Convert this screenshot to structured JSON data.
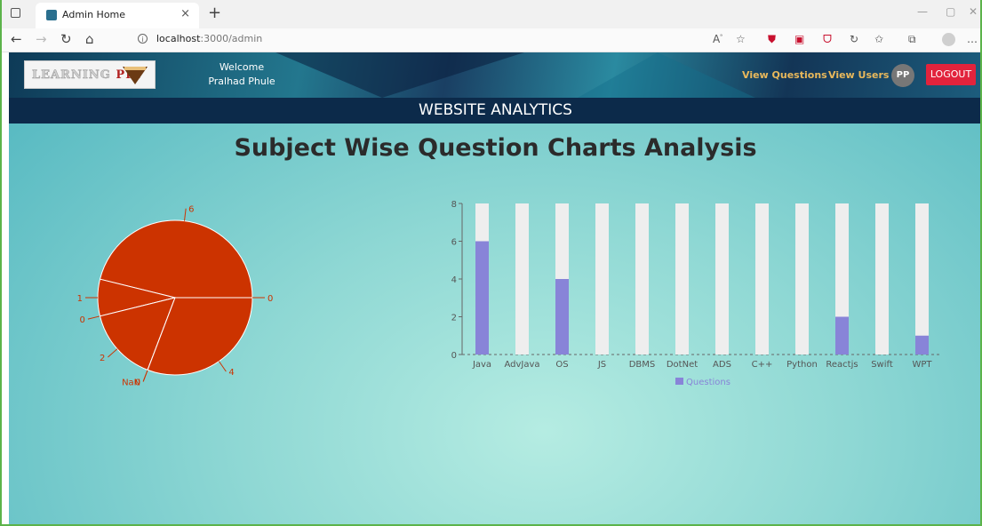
{
  "browser": {
    "tab_title": "Admin Home",
    "url_host": "localhost",
    "url_path": ":3000/admin"
  },
  "header": {
    "logo_part1": "LEARNING",
    "logo_part2": "PIE",
    "welcome_line1": "Welcome",
    "welcome_line2": "Pralhad Phule",
    "view_questions": "View Questions",
    "view_users": "View Users",
    "avatar_initials": "PP",
    "logout_label": "LOGOUT"
  },
  "banner_title": "WEBSITE ANALYTICS",
  "page_heading": "Subject Wise Question Charts Analysis",
  "colors": {
    "pie_fill": "#cc3300",
    "bar_fill": "#8884d8",
    "bar_background": "#eeeeee",
    "logout": "#e2233c",
    "banner": "#0c2a4a"
  },
  "chart_data": [
    {
      "type": "pie",
      "slice_labels": [
        "6",
        "1",
        "0",
        "2",
        "0",
        "NaN",
        "4",
        "0"
      ],
      "values": [
        6,
        1,
        0,
        2,
        0,
        0,
        4,
        0
      ]
    },
    {
      "type": "bar",
      "categories": [
        "Java",
        "AdvJava",
        "OS",
        "JS",
        "DBMS",
        "DotNet",
        "ADS",
        "C++",
        "Python",
        "Reactjs",
        "Swift",
        "WPT"
      ],
      "series": [
        {
          "name": "Questions",
          "values": [
            6,
            0,
            4,
            0,
            0,
            0,
            0,
            0,
            0,
            2,
            0,
            1
          ]
        }
      ],
      "yticks": [
        "0",
        "2",
        "4",
        "6",
        "8"
      ],
      "ylim": [
        0,
        8
      ],
      "legend": "bottom-center"
    }
  ]
}
